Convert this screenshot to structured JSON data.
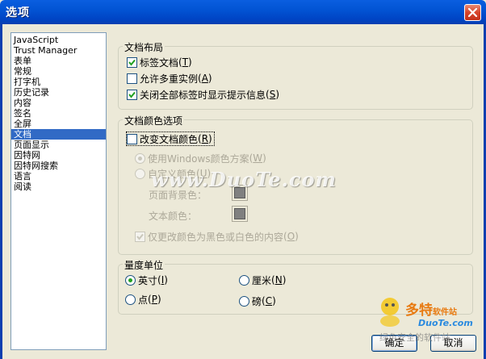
{
  "window": {
    "title": "选项"
  },
  "categories": [
    "JavaScript",
    "Trust Manager",
    "表单",
    "常规",
    "打字机",
    "历史记录",
    "内容",
    "签名",
    "全屏",
    "文档",
    "页面显示",
    "因特网",
    "因特网搜索",
    "语言",
    "阅读"
  ],
  "selected_category": "文档",
  "layout_group": {
    "title": "文档布局",
    "options": [
      {
        "label": "标签文档",
        "key": "T",
        "checked": true
      },
      {
        "label": "允许多重实例",
        "key": "A",
        "checked": false
      },
      {
        "label": "关闭全部标签时显示提示信息",
        "key": "S",
        "checked": true
      }
    ]
  },
  "color_group": {
    "title": "文档颜色选项",
    "change_color": {
      "label": "改变文档颜色",
      "key": "R",
      "checked": false
    },
    "use_windows": {
      "label": "使用Windows颜色方案",
      "key": "W",
      "selected": true,
      "enabled": false
    },
    "custom": {
      "label": "自定义颜色",
      "key": "U",
      "selected": false,
      "enabled": false
    },
    "bg_label": "页面背景色：",
    "text_label": "文本颜色：",
    "only_bw": {
      "label": "仅更改颜色为黑色或白色的内容",
      "key": "O",
      "checked": true,
      "enabled": false
    },
    "swatch_color": "#808080"
  },
  "units_group": {
    "title": "量度单位",
    "options": [
      {
        "label": "英寸",
        "key": "I",
        "selected": true
      },
      {
        "label": "厘米",
        "key": "N",
        "selected": false
      },
      {
        "label": "点",
        "key": "P",
        "selected": false
      },
      {
        "label": "磅",
        "key": "C",
        "selected": false
      }
    ]
  },
  "buttons": {
    "ok": "确定",
    "cancel": "取消"
  },
  "watermarks": {
    "center": "www.DuoTe.com",
    "brand": "多特",
    "brand_suffix": "软件站",
    "url": "DuoTe.com",
    "tagline": "绿色安全的软件站"
  }
}
